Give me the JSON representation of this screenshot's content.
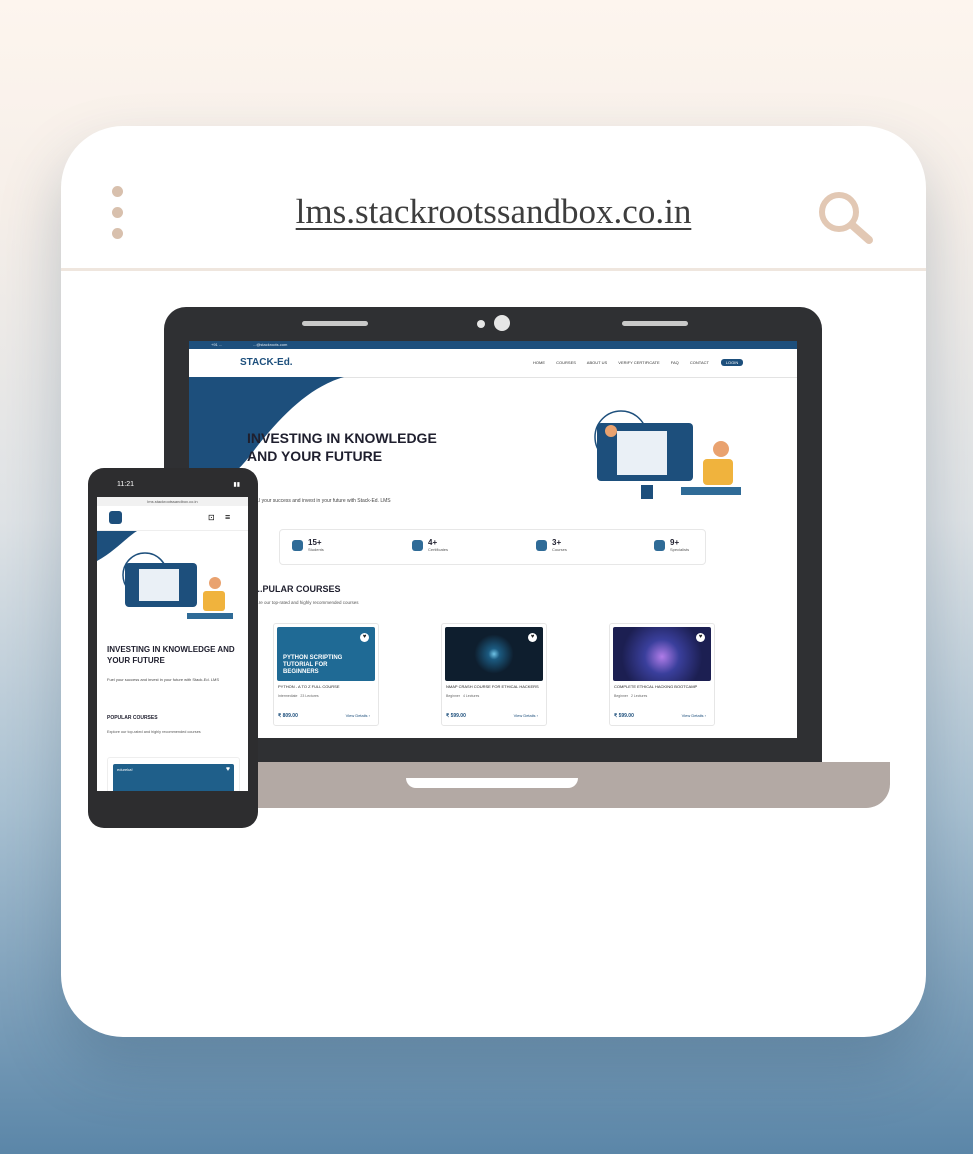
{
  "browser": {
    "url": "lms.stackrootssandbox.co.in",
    "menu_icon": "kebab-menu-icon",
    "search_icon": "search-icon"
  },
  "site": {
    "topbar_phone": "+91 ...",
    "topbar_email": "...@stackroots.com",
    "logo": "STACK-Ed.",
    "nav": [
      "HOME",
      "COURSES",
      "ABOUT US",
      "VERIFY CERTIFICATE",
      "FAQ",
      "CONTACT"
    ],
    "login_label": "LOGIN",
    "hero_title": "INVESTING IN KNOWLEDGE AND YOUR FUTURE",
    "hero_sub": "...l your success and invest in your future with Stack-Ed. LMS",
    "stats": [
      {
        "value": "15+",
        "label": "Students"
      },
      {
        "value": "4+",
        "label": "Certificates"
      },
      {
        "value": "3+",
        "label": "Courses"
      },
      {
        "value": "9+",
        "label": "Specialists"
      }
    ],
    "popular_title": "...PULAR COURSES",
    "popular_sub": "...re our top-rated and highly recommended courses",
    "courses": [
      {
        "title": "PYTHON - A TO Z FULL COURSE",
        "thumb_text": "PYTHON SCRIPTING TUTORIAL FOR BEGINNERS",
        "level": "Intermediate",
        "lectures": "23 Lectures",
        "price": "₹ 809.00",
        "details": "View Details ›",
        "color": "#1f6a95"
      },
      {
        "title": "NMAP CRASH COURSE FOR ETHICAL HACKERS",
        "thumb_text": "",
        "level": "Beginner",
        "lectures": "4 Lectures",
        "price": "₹ 599.00",
        "details": "View Details ›",
        "color": "#0e1e2e"
      },
      {
        "title": "COMPLETE ETHICAL HACKING BOOTCAMP",
        "thumb_text": "",
        "level": "Beginner",
        "lectures": "2 Lectures",
        "price": "₹ 599.00",
        "details": "View Details ›",
        "color": "#2a2d6e"
      }
    ]
  },
  "phone": {
    "time": "11:21",
    "url": "lms.stackrootssandbox.co.in",
    "hero_title": "INVESTING IN KNOWLEDGE AND YOUR FUTURE",
    "hero_sub": "Fuel your success and invest in your future with Stack-Ed. LMS",
    "popular_title": "POPULAR COURSES",
    "popular_sub": "Explore our top-rated and highly recommended courses",
    "card_brand": "edureka!"
  }
}
